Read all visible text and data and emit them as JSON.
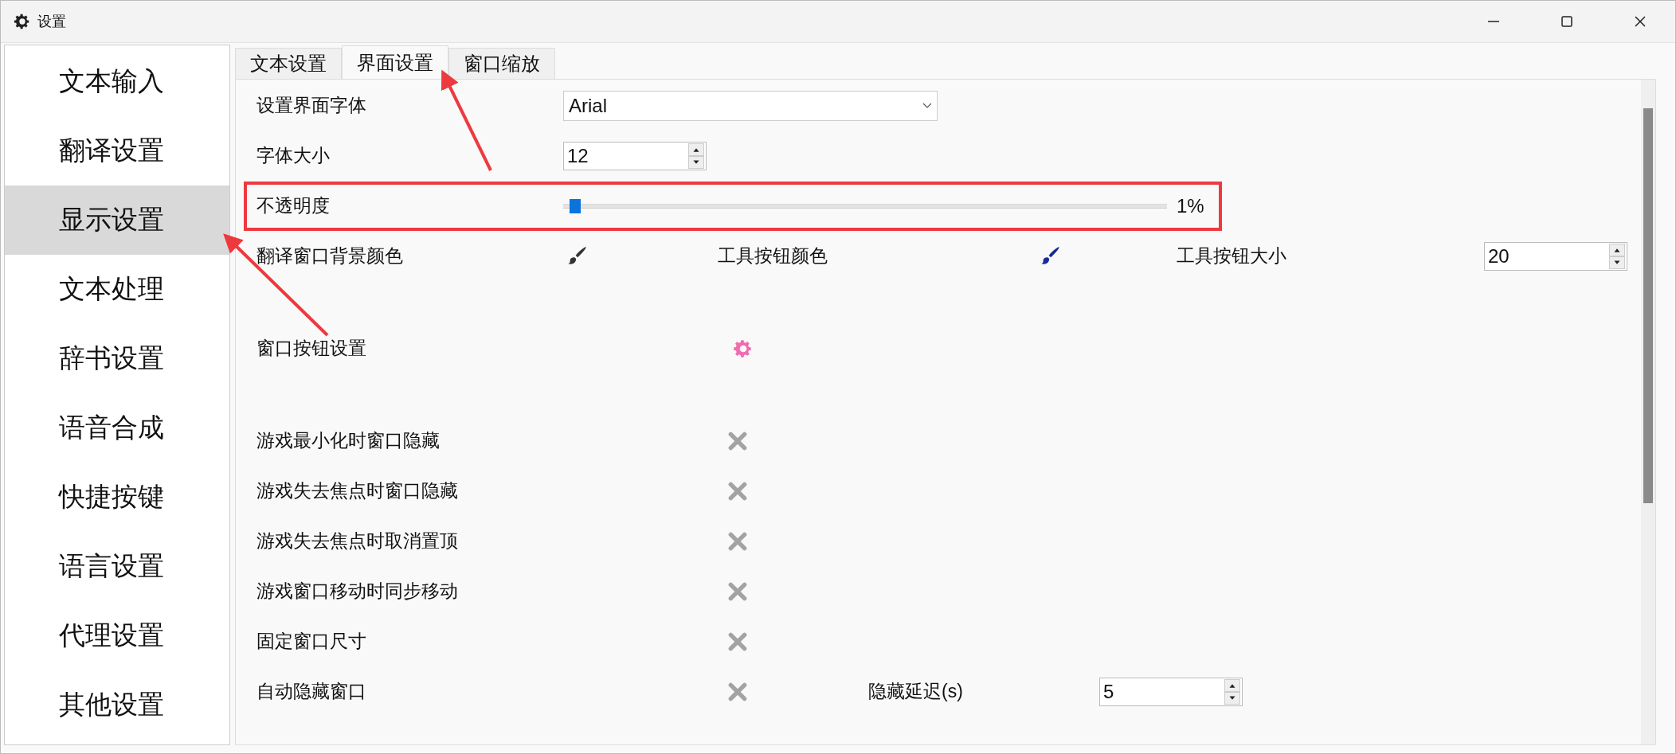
{
  "window": {
    "title": "设置"
  },
  "sidebar": {
    "items": [
      {
        "label": "文本输入",
        "selected": false,
        "pointed": false
      },
      {
        "label": "翻译设置",
        "selected": false,
        "pointed": false
      },
      {
        "label": "显示设置",
        "selected": true,
        "pointed": true
      },
      {
        "label": "文本处理",
        "selected": false,
        "pointed": false
      },
      {
        "label": "辞书设置",
        "selected": false,
        "pointed": false
      },
      {
        "label": "语音合成",
        "selected": false,
        "pointed": false
      },
      {
        "label": "快捷按键",
        "selected": false,
        "pointed": false
      },
      {
        "label": "语言设置",
        "selected": false,
        "pointed": false
      },
      {
        "label": "代理设置",
        "selected": false,
        "pointed": false
      },
      {
        "label": "其他设置",
        "selected": false,
        "pointed": false
      }
    ]
  },
  "tabs": [
    {
      "label": "文本设置",
      "selected": false,
      "pointed": false
    },
    {
      "label": "界面设置",
      "selected": true,
      "pointed": true
    },
    {
      "label": "窗口缩放",
      "selected": false,
      "pointed": false
    }
  ],
  "rows": [
    {
      "kind": "dropdown",
      "label": "设置界面字体",
      "value": "Arial"
    },
    {
      "kind": "spin",
      "label": "字体大小",
      "value": "12"
    },
    {
      "kind": "slider",
      "label": "不透明度",
      "level": 0.01,
      "reading": "1%",
      "highlighted": true
    },
    {
      "kind": "colors",
      "color_buttons": [
        {
          "label": "翻译窗口背景颜色",
          "color": "#333333"
        },
        {
          "label": "工具按钮颜色",
          "color": "#1a2a9a"
        }
      ],
      "extra_label": "工具按钮大小",
      "extra_value": "20"
    },
    {
      "kind": "button",
      "label": "窗口按钮设置"
    },
    {
      "kind": "toggle",
      "label": "游戏最小化时窗口隐藏",
      "on": false
    },
    {
      "kind": "toggle",
      "label": "游戏失去焦点时窗口隐藏",
      "on": false
    },
    {
      "kind": "toggle",
      "label": "游戏失去焦点时取消置顶",
      "on": false
    },
    {
      "kind": "toggle",
      "label": "游戏窗口移动时同步移动",
      "on": false
    },
    {
      "kind": "toggle",
      "label": "固定窗口尺寸",
      "on": false
    },
    {
      "kind": "toggle",
      "label": "自动隐藏窗口",
      "on": false,
      "extra_label": "隐藏延迟(s)",
      "extra_value": "5"
    }
  ]
}
